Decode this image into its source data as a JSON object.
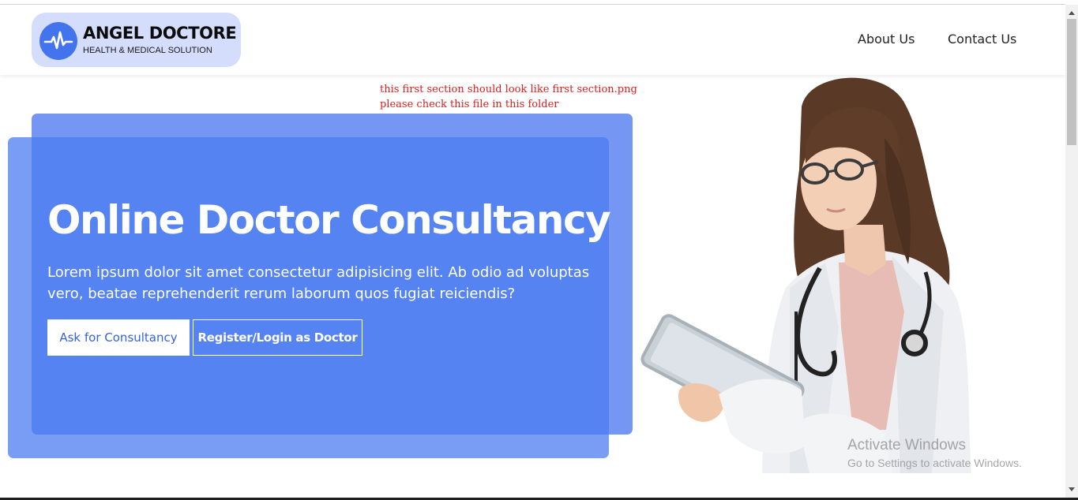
{
  "brand": {
    "name": "ANGEL DOCTORE",
    "tagline": "HEALTH & MEDICAL SOLUTION"
  },
  "nav": {
    "items": [
      {
        "label": "About Us"
      },
      {
        "label": "Contact Us"
      }
    ]
  },
  "dev_note": {
    "line1": "this first section should look like first section.png",
    "line2": "please check this file in this folder"
  },
  "hero": {
    "title": "Online Doctor Consultancy",
    "description": "Lorem ipsum dolor sit amet consectetur adipisicing elit. Ab odio ad voluptas vero, beatae reprehenderit rerum laborum quos fugiat reiciendis?",
    "primary_button": "Ask for Consultancy",
    "secondary_button": "Register/Login as Doctor",
    "image_icon": "doctor-with-tablet-illustration"
  },
  "watermark": {
    "title": "Activate Windows",
    "subtitle": "Go to Settings to activate Windows."
  },
  "colors": {
    "brand_blue": "#4374ee",
    "logo_bg": "#d4ddfb",
    "note_red": "#e01b1b"
  }
}
